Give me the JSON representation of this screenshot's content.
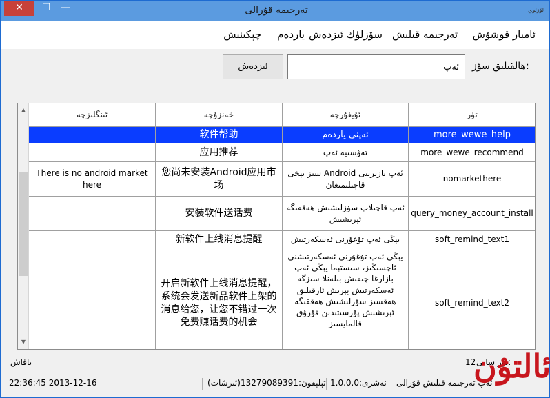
{
  "window": {
    "title": "تەرجىمە قۇرالى",
    "app_icon_label": "ئۆزئوي",
    "close_glyph": "✕",
    "maximize_glyph": "☐",
    "minimize_glyph": "—"
  },
  "menu": {
    "items": [
      "ئامبار قوشۇش",
      "تەرجىمە قىلىش",
      "سۆزلۈك ئىزدەش",
      "ياردەم",
      "چېكىنىش"
    ]
  },
  "search": {
    "label": "ھالقىلىق سۆز:",
    "value": "ئەپ",
    "button": "ئىزدەش"
  },
  "table": {
    "headers": [
      "ئىنگلىزچە",
      "خەنزۇچە",
      "ئۇيغۇرچە",
      "تۈر"
    ],
    "rows": [
      {
        "en": "",
        "zh": "软件帮助",
        "ug": "ئەپنى ياردەم",
        "key": "more_wewe_help",
        "selected": true
      },
      {
        "en": "",
        "zh": "应用推荐",
        "ug": "تەۋسىيە ئەپ",
        "key": "more_wewe_recommend"
      },
      {
        "en": "There is no android market here",
        "zh": "您尚未安装Android应用市场",
        "ug": "سىز تېخى Android ئەپ بازىرىنى قاچىلىمىغان",
        "key": "nomarkethere"
      },
      {
        "en": "",
        "zh": "安装软件送话费",
        "ug": "ئەپ قاچىلاپ سۆزلىشىش ھەققىگە ئېرىشىش",
        "key": "query_money_account_install"
      },
      {
        "en": "",
        "zh": "新软件上线消息提醒",
        "ug": "يېڭى ئەپ تۇغۇرنى ئەسكەرتىش",
        "key": "soft_remind_text1"
      },
      {
        "en": "",
        "zh": "开启新软件上线消息提醒，系统会发送新品软件上架的消息给您，让您不错过一次免费赚话费的机会",
        "ug": "يېڭى ئەپ تۇغۇرنى ئەسكەرتىشنى ئاچسىڭىز، سىستېما يېڭى ئەپ بازارغا چىقىش بىلەنلا سىزگە ئەسكەرتىش بېرىش ئارقىلىق ھەقسىز سۆزلىشىش ھەققىگە ئېرىشىش پۇرسىتىدىن قۇرۇق قالمايسىز",
        "key": "soft_remind_text2"
      }
    ]
  },
  "status": {
    "exit_label": "تاقاش",
    "count_label": "تۈر سانى:",
    "count_value": "12",
    "version": "نەشرى:1.0.0.0",
    "phone": "تېلېفون:13279089391(ئىرشات)",
    "app_name": "ئەپ تەرجىمە قىلىش قۇرالى",
    "datetime": "22:36:45 2013-12-16"
  },
  "watermark": "ئالتۇن"
}
